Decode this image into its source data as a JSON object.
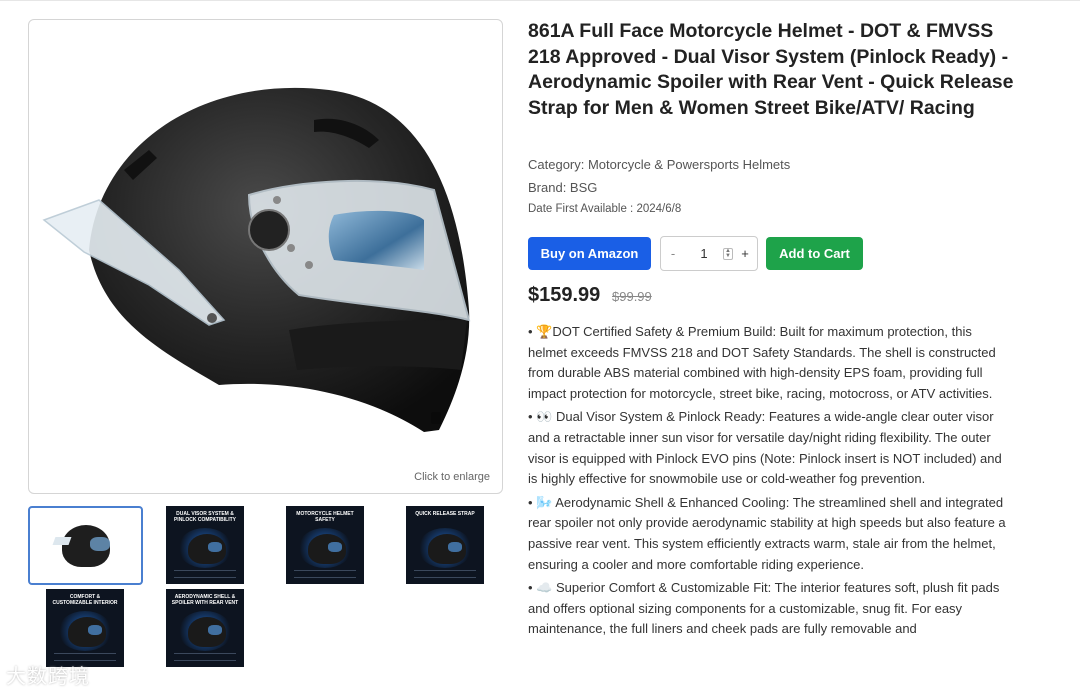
{
  "product": {
    "title": "861A Full Face Motorcycle Helmet - DOT & FMVSS 218 Approved - Dual Visor System (Pinlock Ready) - Aerodynamic Spoiler with Rear Vent - Quick Release Strap for Men & Women Street Bike/ATV/ Racing",
    "category": "Category: Motorcycle & Powersports Helmets",
    "brand": "Brand: BSG",
    "date_available": "Date First Available : 2024/6/8",
    "price": "$159.99",
    "old_price": "$99.99"
  },
  "gallery": {
    "enlarge_label": "Click to enlarge",
    "thumbnails": [
      {
        "caption": ""
      },
      {
        "caption": "DUAL VISOR SYSTEM & PINLOCK COMPATIBILITY"
      },
      {
        "caption": "MOTORCYCLE HELMET SAFETY"
      },
      {
        "caption": "QUICK RELEASE STRAP"
      },
      {
        "caption": "COMFORT & CUSTOMIZABLE INTERIOR"
      },
      {
        "caption": "AERODYNAMIC SHELL & SPOILER WITH REAR VENT"
      }
    ]
  },
  "actions": {
    "buy_amazon": "Buy on Amazon",
    "add_to_cart": "Add to Cart",
    "quantity": "1",
    "minus": "-",
    "plus": "+"
  },
  "bullets": [
    "• 🏆DOT Certified Safety & Premium Build: Built for maximum protection, this helmet exceeds FMVSS 218 and DOT Safety Standards. The shell is constructed from durable ABS material combined with high-density EPS foam, providing full impact protection for motorcycle, street bike, racing, motocross, or ATV activities.",
    "• 👀 Dual Visor System & Pinlock Ready: Features a wide-angle clear outer visor and a retractable inner sun visor for versatile day/night riding flexibility. The outer visor is equipped with Pinlock EVO pins (Note: Pinlock insert is NOT included) and is highly effective for snowmobile use or cold-weather fog prevention.",
    "• 🌬️ Aerodynamic Shell & Enhanced Cooling: The streamlined shell and integrated rear spoiler not only provide aerodynamic stability at high speeds but also feature a passive rear vent. This system efficiently extracts warm, stale air from the helmet, ensuring a cooler and more comfortable riding experience.",
    "• ☁️ Superior Comfort & Customizable Fit: The interior features soft, plush fit pads and offers optional sizing components for a customizable, snug fit. For easy maintenance, the full liners and cheek pads are fully removable and"
  ],
  "watermark": "大数跨境"
}
